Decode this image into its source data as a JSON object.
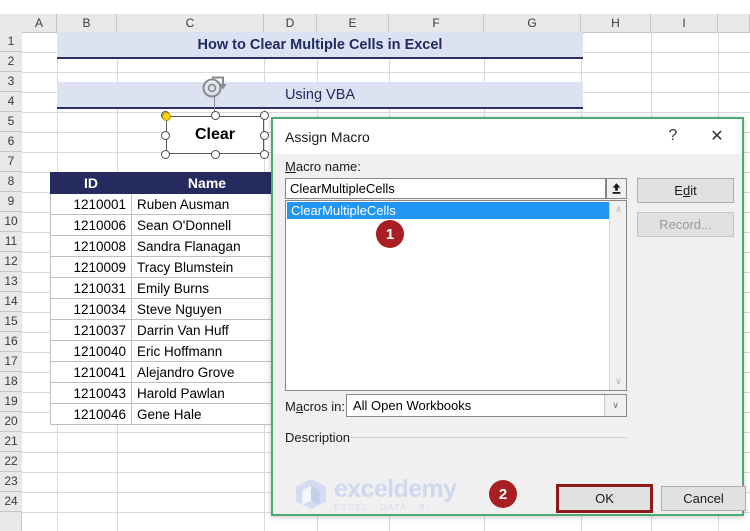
{
  "spreadsheet": {
    "column_headers": [
      "A",
      "B",
      "C",
      "D",
      "E",
      "F",
      "G",
      "H",
      "I"
    ],
    "row_headers": [
      "1",
      "2",
      "3",
      "4",
      "5",
      "6",
      "7",
      "8",
      "9",
      "10",
      "11",
      "12",
      "13",
      "14",
      "15",
      "16",
      "17",
      "18",
      "19",
      "20",
      "21",
      "22",
      "23",
      "24"
    ],
    "banner_title": "How to Clear Multiple Cells in Excel",
    "banner_subtitle": "Using VBA",
    "shape_label": "Clear",
    "table": {
      "headers": [
        "ID",
        "Name"
      ],
      "rows": [
        [
          "1210001",
          "Ruben Ausman"
        ],
        [
          "1210006",
          "Sean O'Donnell"
        ],
        [
          "1210008",
          "Sandra Flanagan"
        ],
        [
          "1210009",
          "Tracy Blumstein"
        ],
        [
          "1210031",
          "Emily Burns"
        ],
        [
          "1210034",
          "Steve Nguyen"
        ],
        [
          "1210037",
          "Darrin Van Huff"
        ],
        [
          "1210040",
          "Eric Hoffmann"
        ],
        [
          "1210041",
          "Alejandro Grove"
        ],
        [
          "1210043",
          "Harold Pawlan"
        ],
        [
          "1210046",
          "Gene Hale"
        ]
      ]
    }
  },
  "dialog": {
    "title": "Assign Macro",
    "help_icon": "?",
    "close_icon": "✕",
    "macro_name_label_prefix": "M",
    "macro_name_label_rest": "acro name:",
    "macro_name_value": "ClearMultipleCells",
    "macro_name_placeholder": "Macro name",
    "spin_icon": "⬆",
    "list_items": [
      "ClearMultipleCells"
    ],
    "scroll_up_icon": "∧",
    "scroll_down_icon": "∨",
    "edit_label_prefix": "E",
    "edit_label_underlined": "d",
    "edit_label_rest": "it",
    "record_label": "Record...",
    "macros_in_label_prefix": "M",
    "macros_in_label_underlined": "a",
    "macros_in_label_rest": "cros in:",
    "macros_in_value": "All Open Workbooks",
    "macros_in_options": [
      "All Open Workbooks"
    ],
    "dropdown_arrow_icon": "∨",
    "description_label": "Description",
    "ok_label": "OK",
    "cancel_label": "Cancel"
  },
  "annotations": {
    "badge_1": "1",
    "badge_2": "2"
  },
  "watermark": {
    "main": "exceldemy",
    "sub": "EXCEL · DATA · BI"
  },
  "colors": {
    "banner_bg": "#dce2f1",
    "banner_text": "#1f2a63",
    "table_header_bg": "#262b5f",
    "selection_blue": "#2196f3",
    "badge_red": "#a81e22",
    "dialog_border_green": "#4daa72",
    "ok_highlight": "#8d1a1a"
  }
}
